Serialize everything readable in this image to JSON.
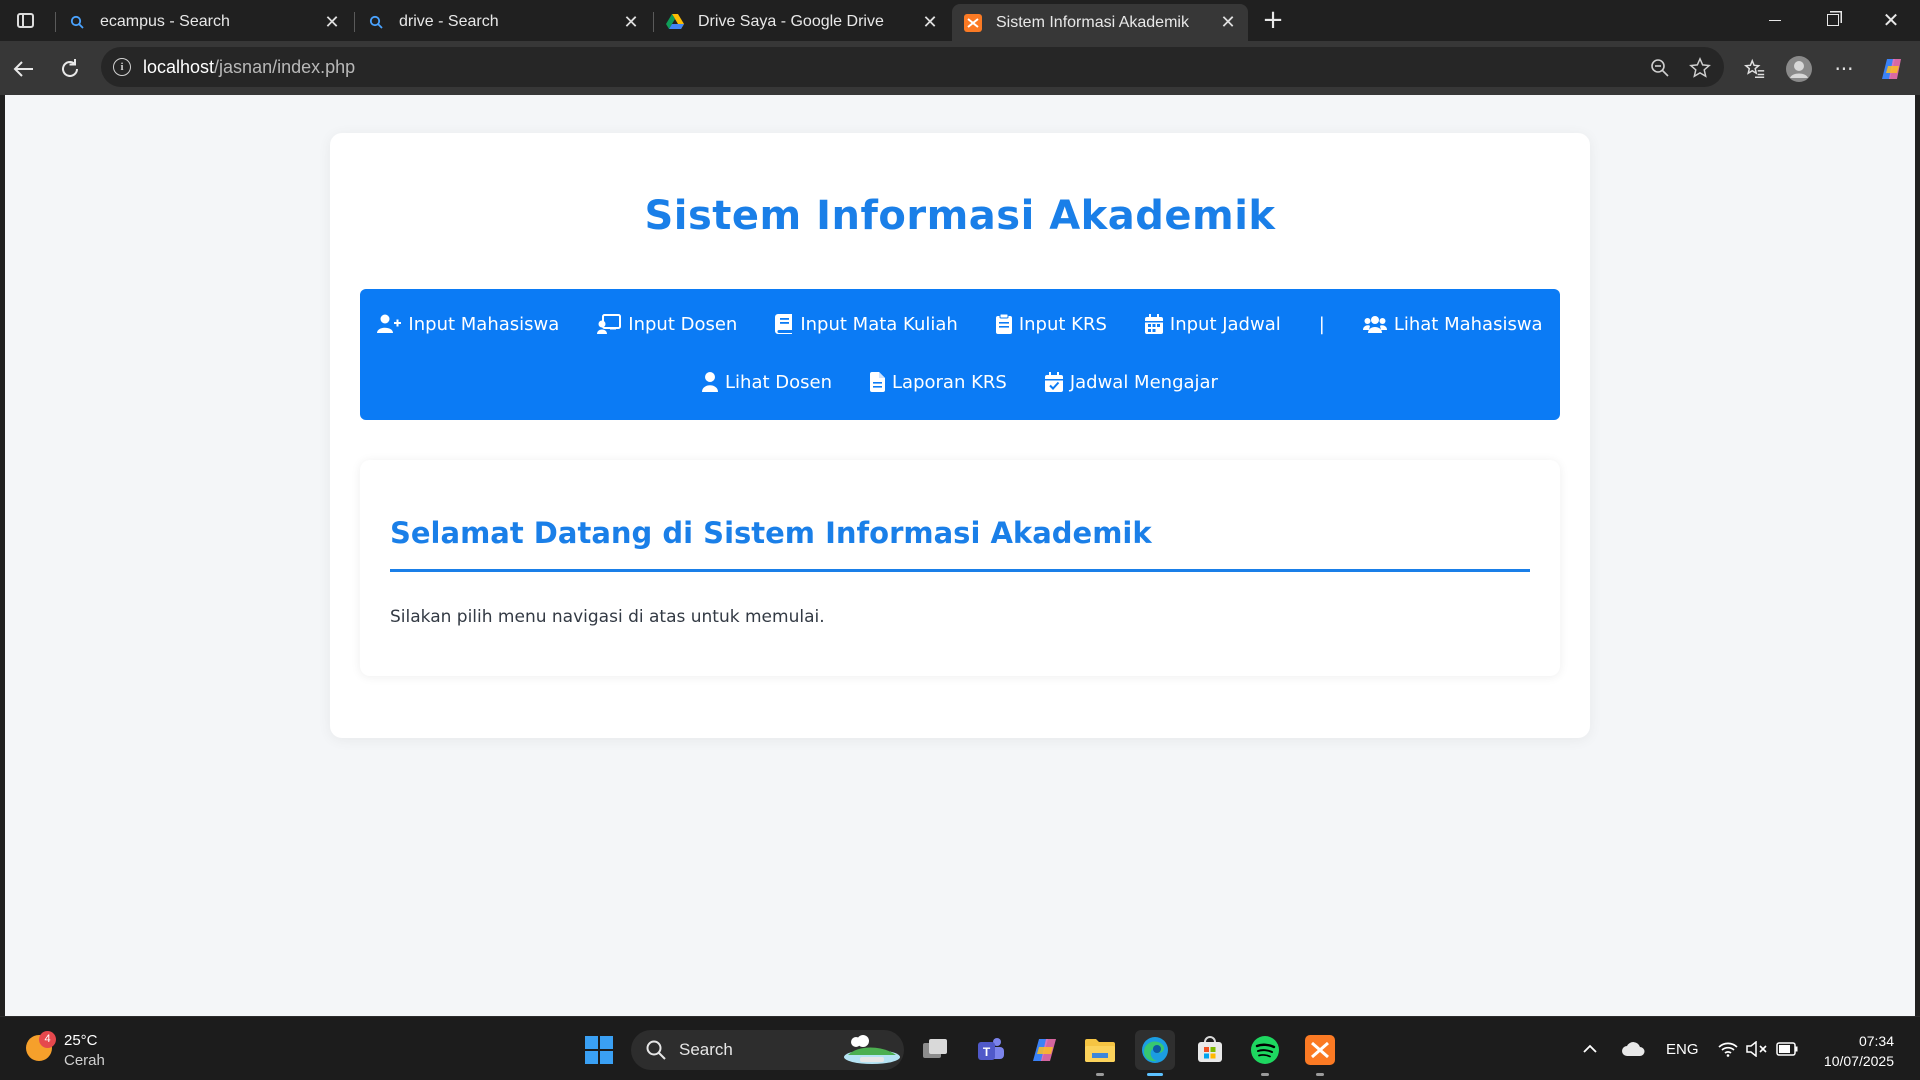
{
  "browser": {
    "tabs": [
      {
        "title": "ecampus - Search",
        "icon": "search-icon",
        "active": false
      },
      {
        "title": "drive - Search",
        "icon": "search-icon",
        "active": false
      },
      {
        "title": "Drive Saya - Google Drive",
        "icon": "google-drive-icon",
        "active": false
      },
      {
        "title": "Sistem Informasi Akademik",
        "icon": "xampp-icon",
        "active": true
      }
    ],
    "address": {
      "host": "localhost",
      "path": "/jasnan/index.php"
    }
  },
  "page": {
    "title": "Sistem Informasi Akademik",
    "menu_row1": [
      {
        "label": "Input Mahasiswa",
        "icon": "user-plus-icon"
      },
      {
        "label": "Input Dosen",
        "icon": "chalkboard-teacher-icon"
      },
      {
        "label": "Input Mata Kuliah",
        "icon": "book-icon"
      },
      {
        "label": "Input KRS",
        "icon": "clipboard-icon"
      },
      {
        "label": "Input Jadwal",
        "icon": "calendar-icon"
      }
    ],
    "menu_separator": "|",
    "menu_row1_after": [
      {
        "label": "Lihat Mahasiswa",
        "icon": "users-icon"
      }
    ],
    "menu_row2": [
      {
        "label": "Lihat Dosen",
        "icon": "user-icon"
      },
      {
        "label": "Laporan KRS",
        "icon": "file-icon"
      },
      {
        "label": "Jadwal Mengajar",
        "icon": "calendar-check-icon"
      }
    ],
    "welcome": {
      "heading": "Selamat Datang di Sistem Informasi Akademik",
      "text": "Silakan pilih menu navigasi di atas untuk memulai."
    }
  },
  "taskbar": {
    "weather": {
      "temp": "25°C",
      "condition": "Cerah",
      "badge": "4"
    },
    "search_label": "Search",
    "tray": {
      "language": "ENG"
    },
    "clock": {
      "time": "07:34",
      "date": "10/07/2025"
    }
  },
  "colors": {
    "accent": "#0b7bf5",
    "title_blue": "#1a7fe8",
    "page_bg": "#f4f6f8"
  }
}
